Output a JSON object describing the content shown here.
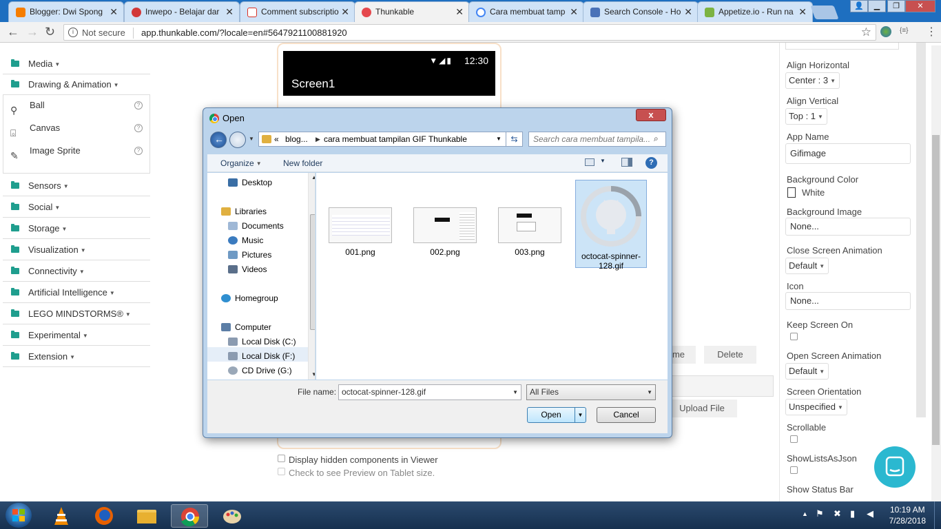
{
  "browser": {
    "tabs": [
      {
        "label": "Blogger: Dwi Spong",
        "icon_color": "#f57d00"
      },
      {
        "label": "Inwepo - Belajar dar",
        "icon_color": "#d23838"
      },
      {
        "label": "Comment subscriptio",
        "icon_color": "#d93025"
      },
      {
        "label": "Thunkable",
        "icon_color": "#e5484d"
      },
      {
        "label": "Cara membuat tamp",
        "icon_color": "#4285f4"
      },
      {
        "label": "Search Console - Ho",
        "icon_color": "#4a72b8"
      },
      {
        "label": "Appetize.io - Run na",
        "icon_color": "#7cb342"
      }
    ],
    "address": {
      "security": "Not secure",
      "url": "app.thunkable.com/?locale=en#5647921100881920"
    },
    "ext_label": "{≡}"
  },
  "palette": {
    "categories_top": [
      {
        "label": "Media"
      },
      {
        "label": "Drawing & Animation"
      }
    ],
    "drawing_components": [
      {
        "label": "Ball",
        "icon": "ball-icon"
      },
      {
        "label": "Canvas",
        "icon": "canvas-icon"
      },
      {
        "label": "Image Sprite",
        "icon": "image-sprite-icon"
      }
    ],
    "categories_bottom": [
      {
        "label": "Sensors"
      },
      {
        "label": "Social"
      },
      {
        "label": "Storage"
      },
      {
        "label": "Visualization"
      },
      {
        "label": "Connectivity"
      },
      {
        "label": "Artificial Intelligence"
      },
      {
        "label": "LEGO MINDSTORMS®"
      },
      {
        "label": "Experimental"
      },
      {
        "label": "Extension"
      }
    ]
  },
  "viewer": {
    "time": "12:30",
    "screen_title": "Screen1",
    "hidden_components_label": "Display hidden components in Viewer",
    "tablet_preview_label": "Check to see Preview on Tablet size."
  },
  "media": {
    "rename_label": "me",
    "delete_label": "Delete",
    "upload_label": "Upload File"
  },
  "properties": {
    "align_horizontal": {
      "label": "Align Horizontal",
      "value": "Center : 3"
    },
    "align_vertical": {
      "label": "Align Vertical",
      "value": "Top : 1"
    },
    "app_name": {
      "label": "App Name",
      "value": "Gifimage"
    },
    "background_color": {
      "label": "Background Color",
      "value": "White"
    },
    "background_image": {
      "label": "Background Image",
      "value": "None..."
    },
    "close_screen_animation": {
      "label": "Close Screen Animation",
      "value": "Default"
    },
    "icon": {
      "label": "Icon",
      "value": "None..."
    },
    "keep_screen_on": {
      "label": "Keep Screen On"
    },
    "open_screen_animation": {
      "label": "Open Screen Animation",
      "value": "Default"
    },
    "screen_orientation": {
      "label": "Screen Orientation",
      "value": "Unspecified"
    },
    "scrollable": {
      "label": "Scrollable"
    },
    "show_lists_as_json": {
      "label": "ShowListsAsJson"
    },
    "show_status_bar": {
      "label": "Show Status Bar"
    }
  },
  "dialog": {
    "title": "Open",
    "close_label": "x",
    "path_prefix": "«",
    "path_parts": [
      "blog...",
      "cara membuat tampilan GIF Thunkable"
    ],
    "search_placeholder": "Search cara membuat tampila...",
    "organize_label": "Organize",
    "new_folder_label": "New folder",
    "nav_items": [
      {
        "label": "Desktop",
        "icon_color": "#3a6ea5"
      },
      {
        "label": "Libraries",
        "icon_color": "#e0b040"
      },
      {
        "label": "Documents",
        "icon_color": "#9fb8d6"
      },
      {
        "label": "Music",
        "icon_color": "#3b7bbf"
      },
      {
        "label": "Pictures",
        "icon_color": "#6f9ac4"
      },
      {
        "label": "Videos",
        "icon_color": "#5a6f8a"
      },
      {
        "label": "Homegroup",
        "icon_color": "#2f8fd0"
      },
      {
        "label": "Computer",
        "icon_color": "#5c7ea6"
      },
      {
        "label": "Local Disk (C:)",
        "icon_color": "#8b9bb0"
      },
      {
        "label": "Local Disk (F:)",
        "icon_color": "#8b9bb0"
      },
      {
        "label": "CD Drive (G:)",
        "icon_color": "#9aa8b8"
      }
    ],
    "files": [
      {
        "name": "001.png",
        "selected": false
      },
      {
        "name": "002.png",
        "selected": false
      },
      {
        "name": "003.png",
        "selected": false
      },
      {
        "name": "octocat-spinner-128.gif",
        "selected": true
      }
    ],
    "filename_label": "File name:",
    "filename_value": "octocat-spinner-128.gif",
    "filetype_value": "All Files",
    "open_label": "Open",
    "cancel_label": "Cancel"
  },
  "taskbar": {
    "time": "10:19 AM",
    "date": "7/28/2018"
  },
  "colors": {
    "accent": "#1f9e8e",
    "chrome_blue": "#1e6fc0",
    "chat": "#2bb8d0"
  }
}
